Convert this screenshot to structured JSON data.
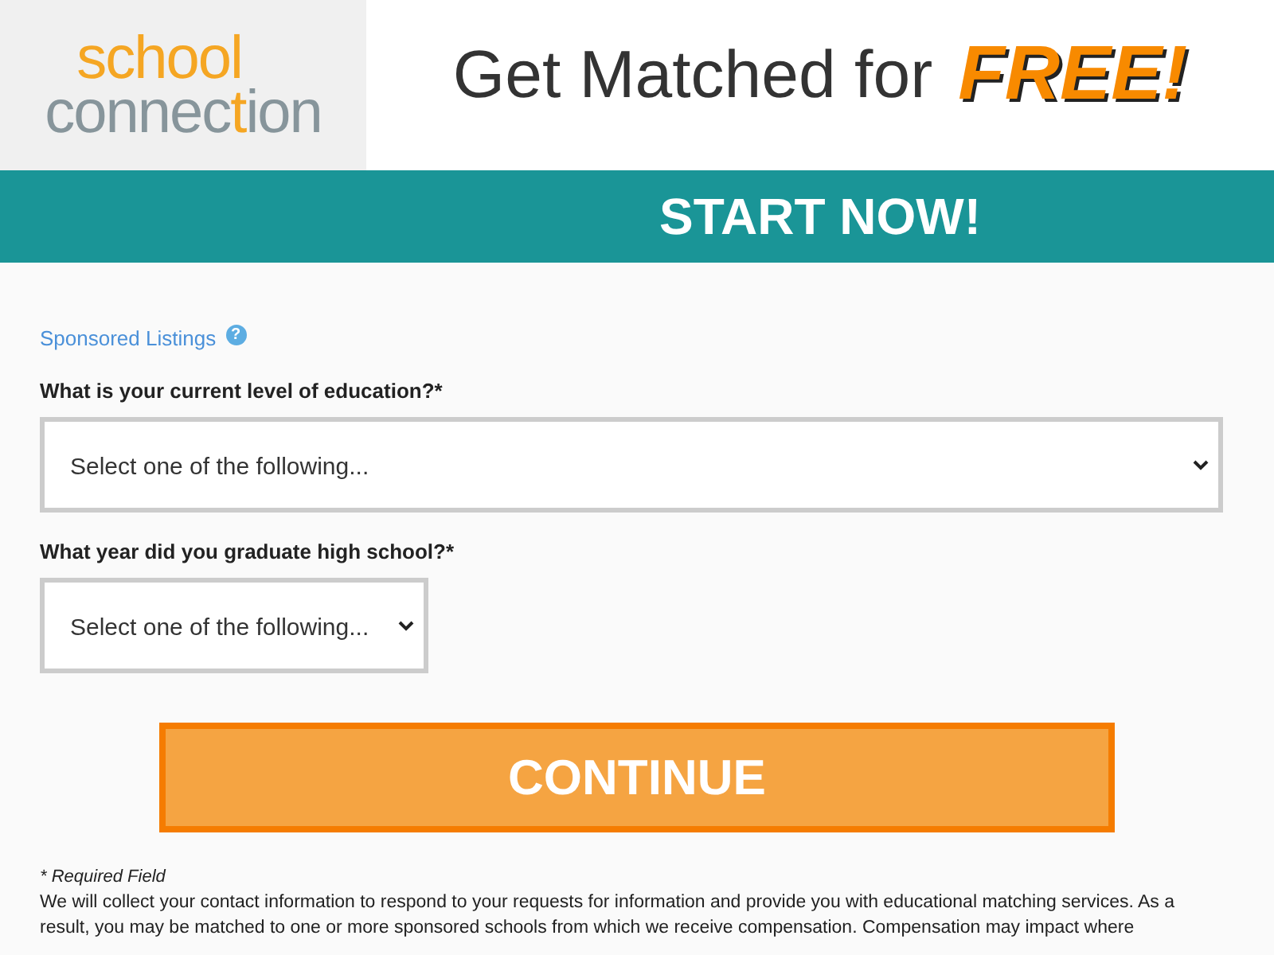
{
  "logo": {
    "line_1": "school",
    "line_2_parts": [
      {
        "text": "connec",
        "accent": false
      },
      {
        "text": "t",
        "accent": true
      },
      {
        "text": "ion",
        "accent": false
      }
    ]
  },
  "header": {
    "headline": "Get Matched for",
    "emphasis": "FREE!"
  },
  "banner": {
    "title": "START NOW!"
  },
  "sponsored": {
    "label": "Sponsored Listings",
    "help_icon": "?"
  },
  "questions": [
    {
      "label": "What is your current level of education?*",
      "value": "Select one of the following...",
      "kind": "full"
    },
    {
      "label": "What year did you graduate high school?*",
      "value": "Select one of the following...",
      "kind": "compact"
    }
  ],
  "continue_button": "CONTINUE",
  "footer": {
    "required_note": "* Required Field",
    "disclosure": "We will collect your contact information to respond to your requests for information and provide you with educational matching services. As a result, you may be matched to one or more sponsored schools from which we receive compensation. Compensation may impact where"
  }
}
